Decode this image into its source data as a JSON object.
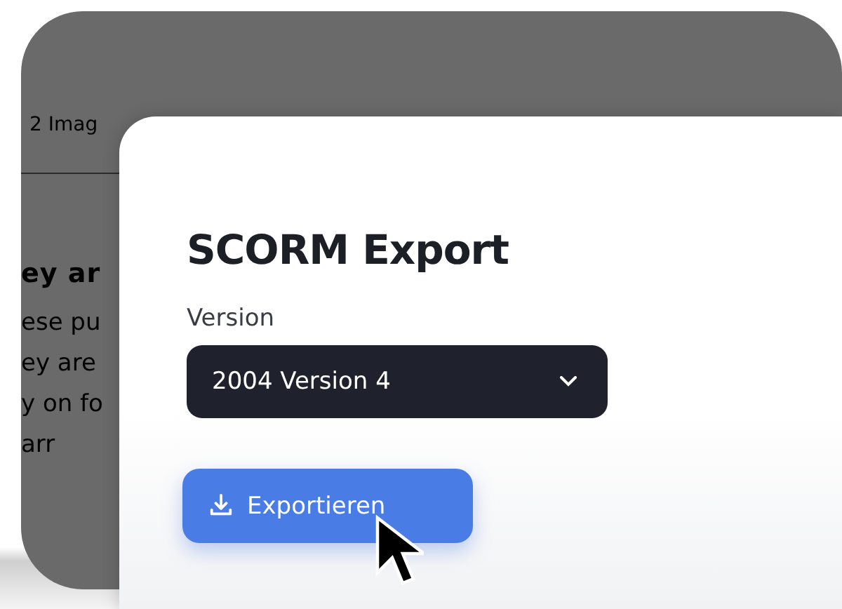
{
  "background_app": {
    "tab_label": "2 Imag",
    "heading": "ey ar",
    "lines": [
      "ese pu",
      "ey are",
      "y on fo",
      "arr"
    ]
  },
  "dialog": {
    "title": "SCORM Export",
    "field_label": "Version",
    "select_value": "2004 Version 4",
    "export_button": "Exportieren"
  }
}
